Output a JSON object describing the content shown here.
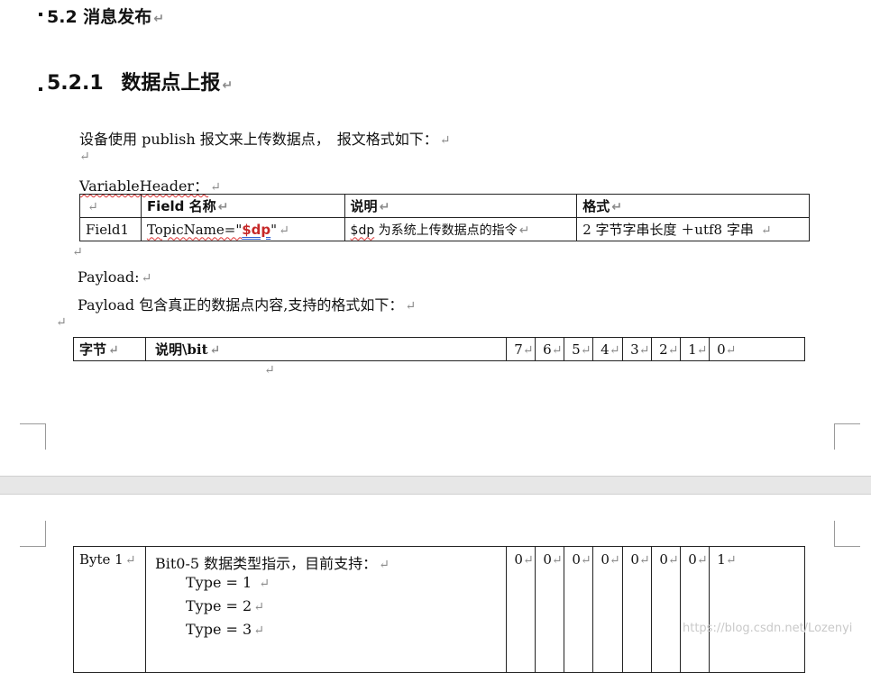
{
  "headings": {
    "h2": "5.2 消息发布",
    "h3_number": "5.2.1",
    "h3_title": "数据点上报"
  },
  "paragraph_mark": "↵",
  "intro": "设备使用 publish 报文来上传数据点，　报文格式如下：",
  "variable_header_label": "VariableHeader：",
  "vh_table": {
    "headers": [
      "",
      "Field 名称",
      "说明",
      "格式"
    ],
    "row": {
      "field": "Field1",
      "topic_prefix": "TopicName=\"",
      "topic_value": "$dp",
      "topic_suffix": "\"",
      "desc_dp": "$dp",
      "desc_rest": " 为系统上传数据点的指令",
      "format": "2 字节字串长度 ＋utf8 字串"
    }
  },
  "payload_label": "Payload:",
  "payload_desc": "Payload 包含真正的数据点内容,支持的格式如下：",
  "bit_table": {
    "header_byte": "字节",
    "header_desc": "说明\\bit",
    "bits": [
      "7",
      "6",
      "5",
      "4",
      "3",
      "2",
      "1",
      "0"
    ]
  },
  "byte_table": {
    "byte": "Byte 1",
    "desc": "Bit0-5 数据类型指示，目前支持：",
    "bits": [
      "0",
      "0",
      "0",
      "0",
      "0",
      "0",
      "0",
      "1"
    ],
    "types": [
      "Type = 1",
      "Type = 2",
      "Type = 3"
    ]
  },
  "watermark": "https://blog.csdn.net/Lozenyi"
}
